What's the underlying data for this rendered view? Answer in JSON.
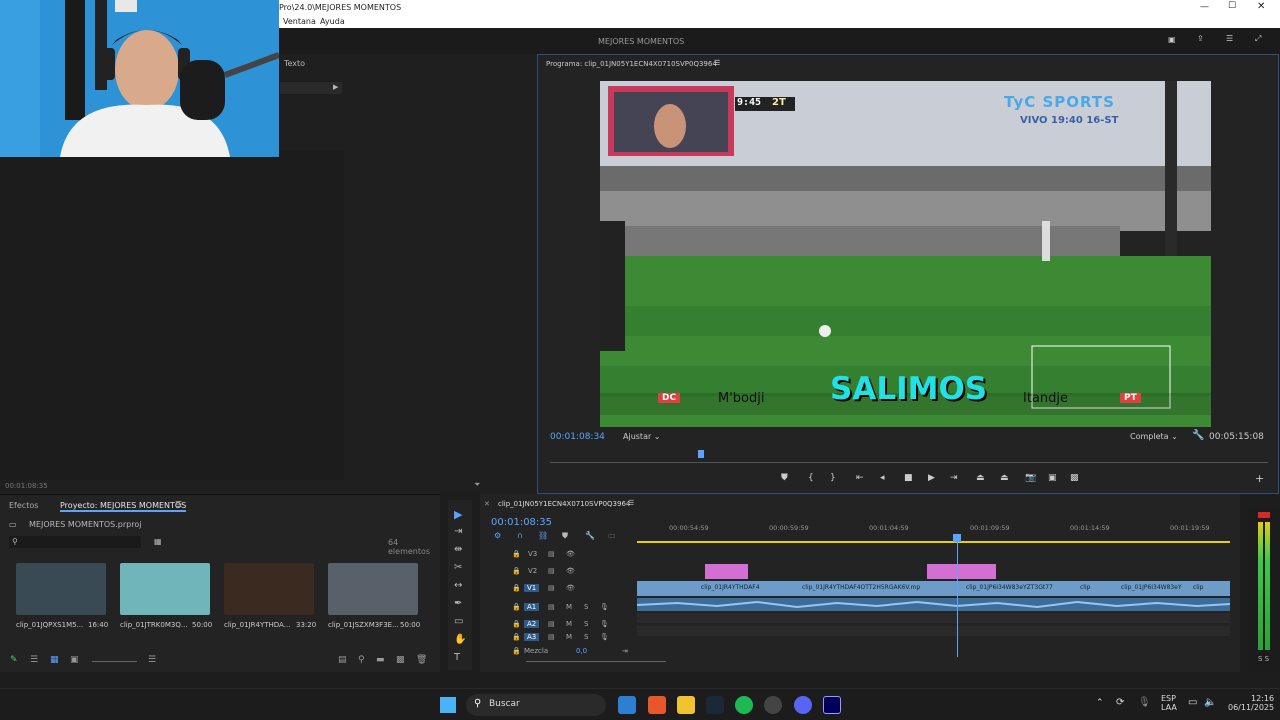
{
  "window": {
    "title": "Pro\\24.0\\MEJORES MOMENTOS",
    "menu": [
      "Ventana",
      "Ayuda"
    ],
    "header_title": "MEJORES MOMENTOS"
  },
  "left_panel": {
    "tab_text": "Texto",
    "timecode": "00:01:08:35"
  },
  "program": {
    "title": "Programa: clip_01JN05Y1ECN4X0710SVP0Q3964",
    "timecode_current": "00:01:08:34",
    "fit": "Ajustar",
    "quality": "Completa",
    "timecode_duration": "00:05:15:08",
    "video": {
      "channel_logo": "TyC SPORTS",
      "live_label": "VIVO 19:40 16-ST",
      "game_clock": "9:45",
      "game_period": "2T",
      "overlay_text": "SALIMOS",
      "player_left": "M'bodji",
      "player_right": "Itandje",
      "badge_left": "DC",
      "badge_right": "PT"
    }
  },
  "project": {
    "tab_effects": "Efectos",
    "tab_project": "Proyecto: MEJORES MOMENTOS",
    "file": "MEJORES MOMENTOS.prproj",
    "count": "64 elementos",
    "search_placeholder": "",
    "clips": [
      {
        "name": "clip_01JQPXS1M5...",
        "duration": "16:40",
        "color": "#3a4a55"
      },
      {
        "name": "clip_01JTRK0M3Q...",
        "duration": "50:00",
        "color": "#6fb5b9"
      },
      {
        "name": "clip_01JR4YTHDA...",
        "duration": "33:20",
        "color": "#3a2a20"
      },
      {
        "name": "clip_01JSZXM3F3E...",
        "duration": "50:00",
        "color": "#58606a"
      }
    ]
  },
  "timeline": {
    "sequence_title": "clip_01JN05Y1ECN4X0710SVP0Q3964",
    "timecode": "00:01:08:35",
    "ruler": [
      "00:00:54:59",
      "00:00:59:59",
      "00:01:04:59",
      "00:01:09:59",
      "00:01:14:59",
      "00:01:19:59"
    ],
    "tracks": [
      "V3",
      "V2",
      "V1",
      "A1",
      "A2",
      "A3"
    ],
    "mix_label": "Mezcla",
    "mix_value": "0,0",
    "clip_labels": [
      "clip_01JR4YTHDAF4",
      "clip_01JR4YTHDAF4OTT2H5RGAK6V.mp",
      "clip_01JP6I34W83eYZT3Gt77",
      "clip",
      "clip_01JP6I34W83eY",
      "clip"
    ],
    "meter_label": "S S"
  },
  "taskbar": {
    "search": "Buscar",
    "lang": "ESP",
    "lang_sub": "LAA",
    "time": "12:16",
    "date": "06/11/2025"
  }
}
